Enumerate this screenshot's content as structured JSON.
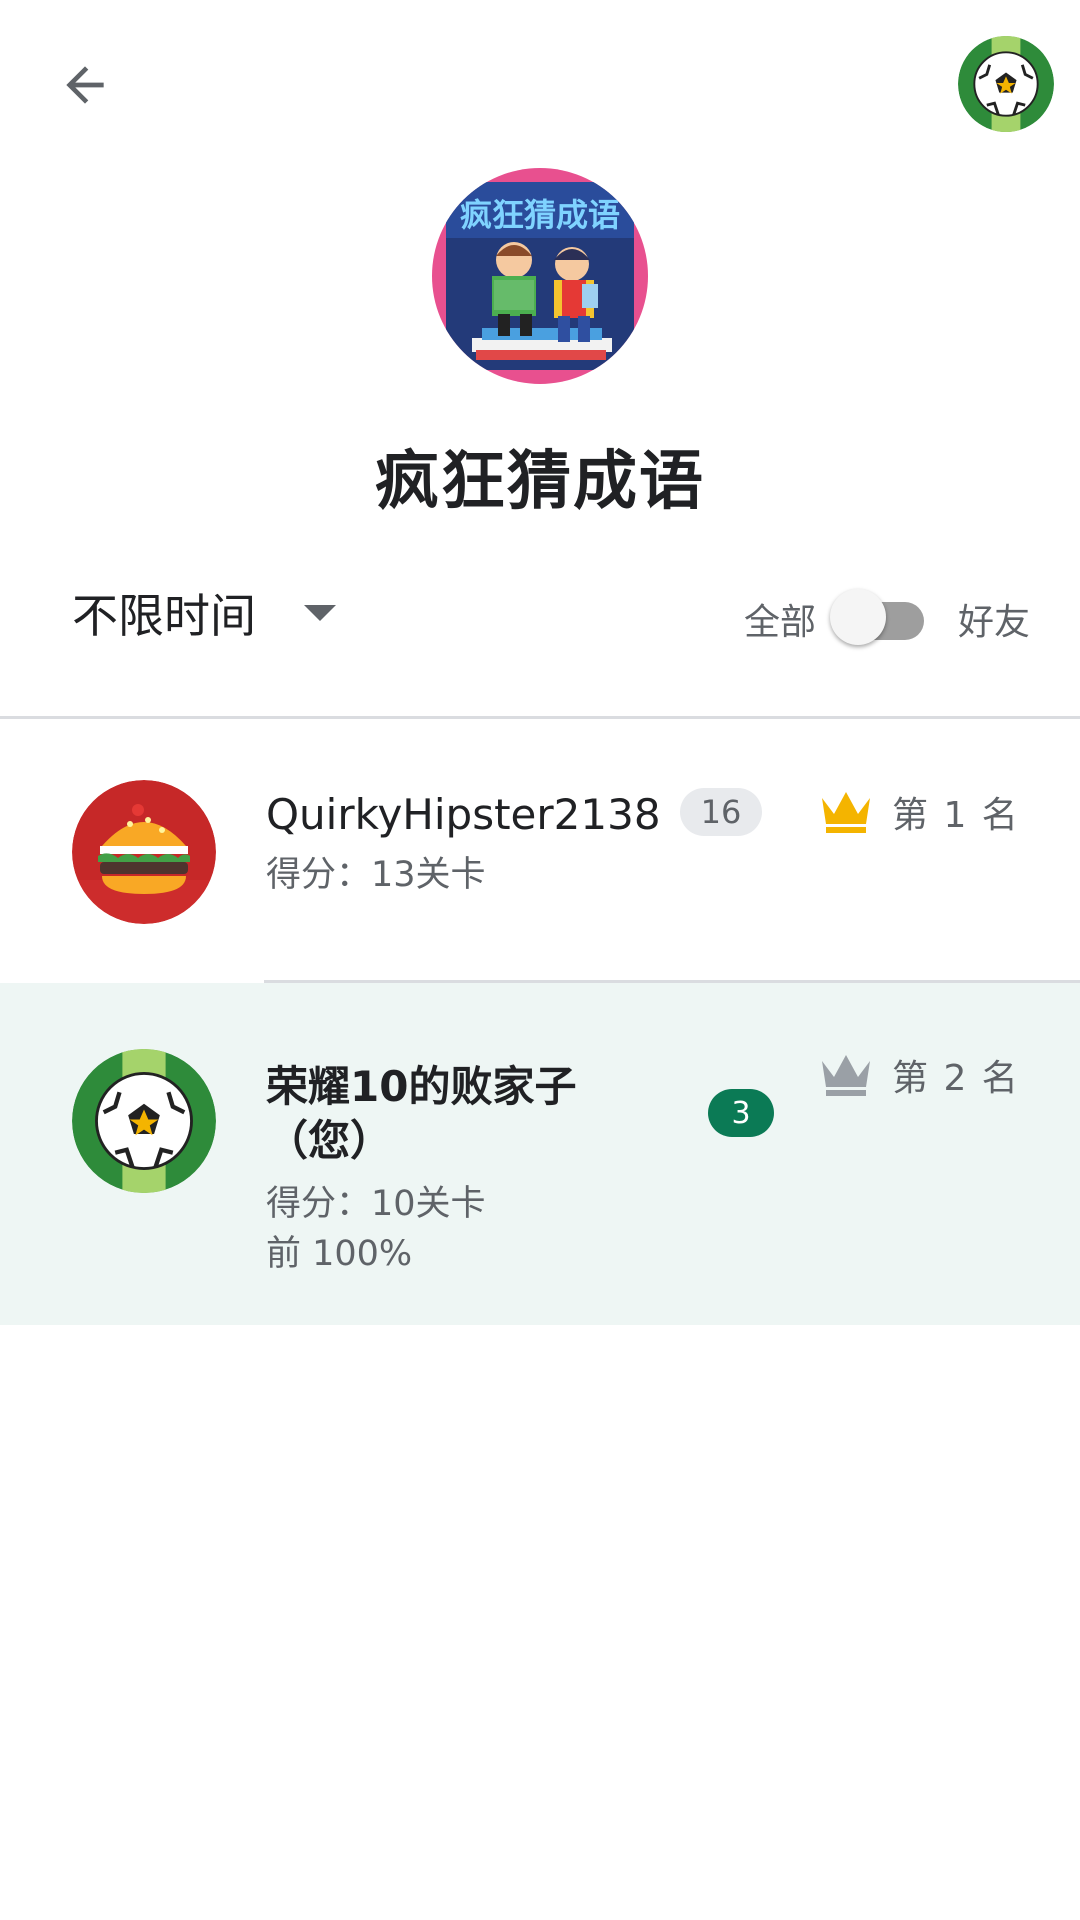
{
  "header": {
    "game_title": "疯狂猜成语",
    "game_icon_text": "疯狂猜成语"
  },
  "filters": {
    "time_range": "不限时间",
    "scope_all": "全部",
    "scope_friends": "好友",
    "friends_only_enabled": false
  },
  "leaderboard": [
    {
      "name": "QuirkyHipster2138",
      "level": "16",
      "score": "得分：13关卡",
      "rank": "第 1 名",
      "avatar": "burger-icon",
      "crown_color": "#f4b400"
    },
    {
      "name_line1": "荣耀10的败家子",
      "name_line2": "（您）",
      "level": "3",
      "score": "得分：10关卡",
      "percentile": "前 100%",
      "rank": "第 2 名",
      "avatar": "soccer-ball-icon",
      "crown_color": "#9aa0a6"
    }
  ],
  "colors": {
    "accent_green": "#0b7a55",
    "highlight_row": "#eef6f4",
    "gold": "#f4b400",
    "silver": "#9aa0a6"
  }
}
